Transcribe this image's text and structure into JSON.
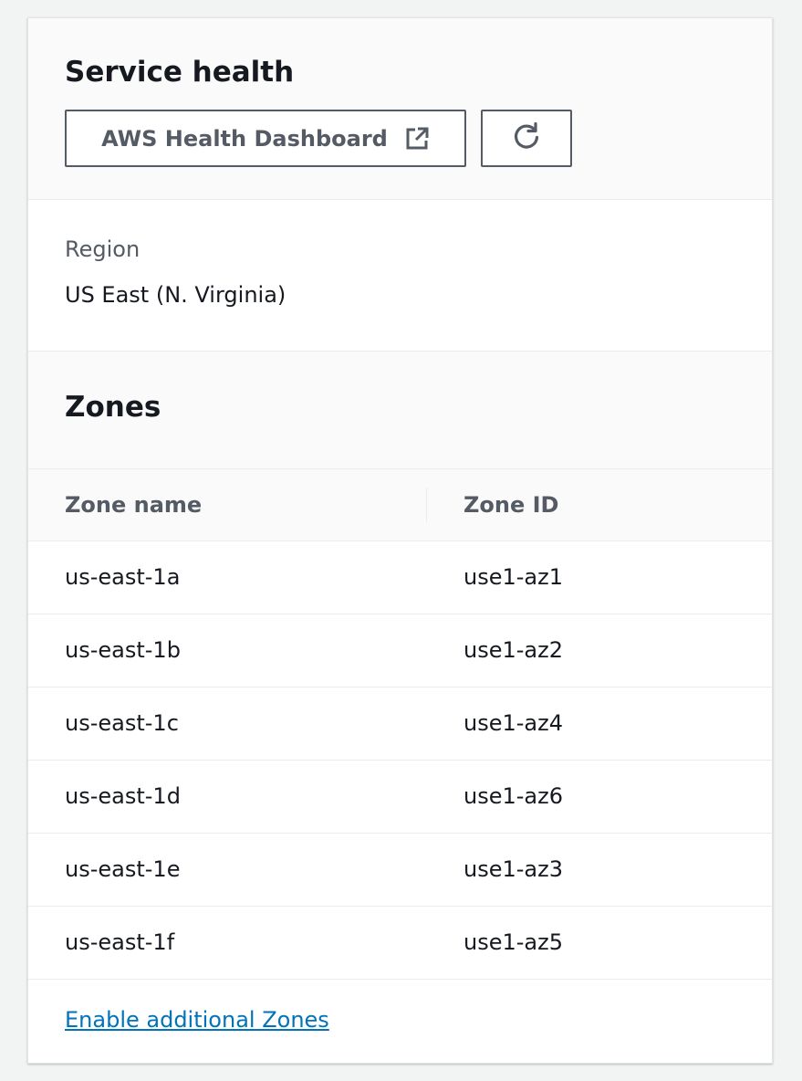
{
  "header": {
    "title": "Service health",
    "dashboard_button_label": "AWS Health Dashboard",
    "dashboard_button_icon": "external-link-icon",
    "refresh_button_icon": "refresh-icon"
  },
  "region": {
    "label": "Region",
    "value": "US East (N. Virginia)"
  },
  "zones": {
    "title": "Zones",
    "columns": [
      "Zone name",
      "Zone ID"
    ],
    "rows": [
      {
        "name": "us-east-1a",
        "id": "use1-az1"
      },
      {
        "name": "us-east-1b",
        "id": "use1-az2"
      },
      {
        "name": "us-east-1c",
        "id": "use1-az4"
      },
      {
        "name": "us-east-1d",
        "id": "use1-az6"
      },
      {
        "name": "us-east-1e",
        "id": "use1-az3"
      },
      {
        "name": "us-east-1f",
        "id": "use1-az5"
      }
    ]
  },
  "footer": {
    "link_label": "Enable additional Zones"
  },
  "colors": {
    "link": "#0073bb",
    "text": "#16191f",
    "muted": "#545b64",
    "background": "#f2f3f3"
  }
}
